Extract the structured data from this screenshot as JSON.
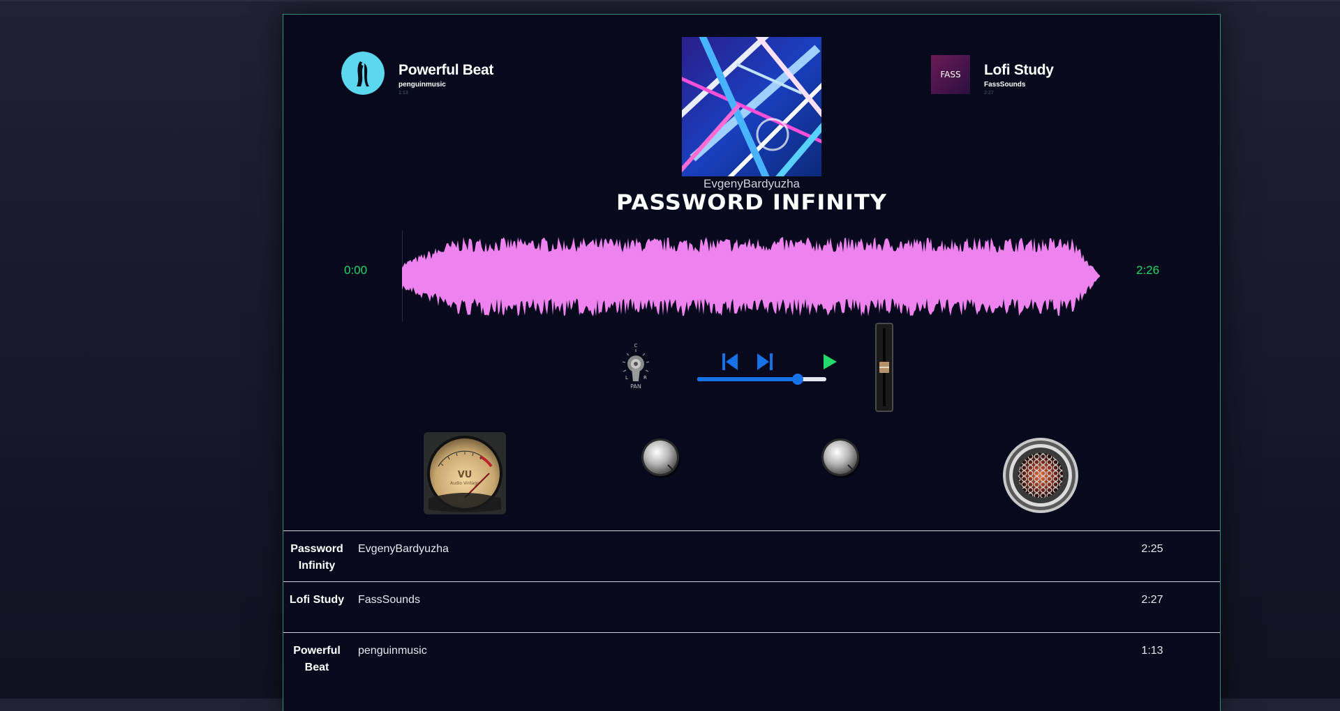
{
  "side_tracks": {
    "previous": {
      "title": "Powerful Beat",
      "artist": "penguinmusic",
      "duration": "1:13"
    },
    "next": {
      "title": "Lofi Study",
      "artist": "FassSounds",
      "duration": "2:27",
      "cover_text": "FASS"
    }
  },
  "current": {
    "artist": "EvgenyBardyuzha",
    "title": "PASSWORD INFINITY",
    "time_elapsed": "0:00",
    "time_total": "2:26",
    "waveform_color": "#ee82ee"
  },
  "controls": {
    "pan_label": "PAN",
    "pan_marks": {
      "center": "C",
      "left": "L",
      "right": "R"
    },
    "volume_percent": 78,
    "fader_level": 0.5,
    "accent_blue": "#1672e6",
    "play_green": "#23d96a"
  },
  "vu_meter": {
    "label": "VU",
    "sublabel": "Audio Vintage"
  },
  "playlist": [
    {
      "title": "Password Infinity",
      "artist": "EvgenyBardyuzha",
      "duration": "2:25"
    },
    {
      "title": "Lofi Study",
      "artist": "FassSounds",
      "duration": "2:27"
    },
    {
      "title": "Powerful Beat",
      "artist": "penguinmusic",
      "duration": "1:13"
    }
  ]
}
